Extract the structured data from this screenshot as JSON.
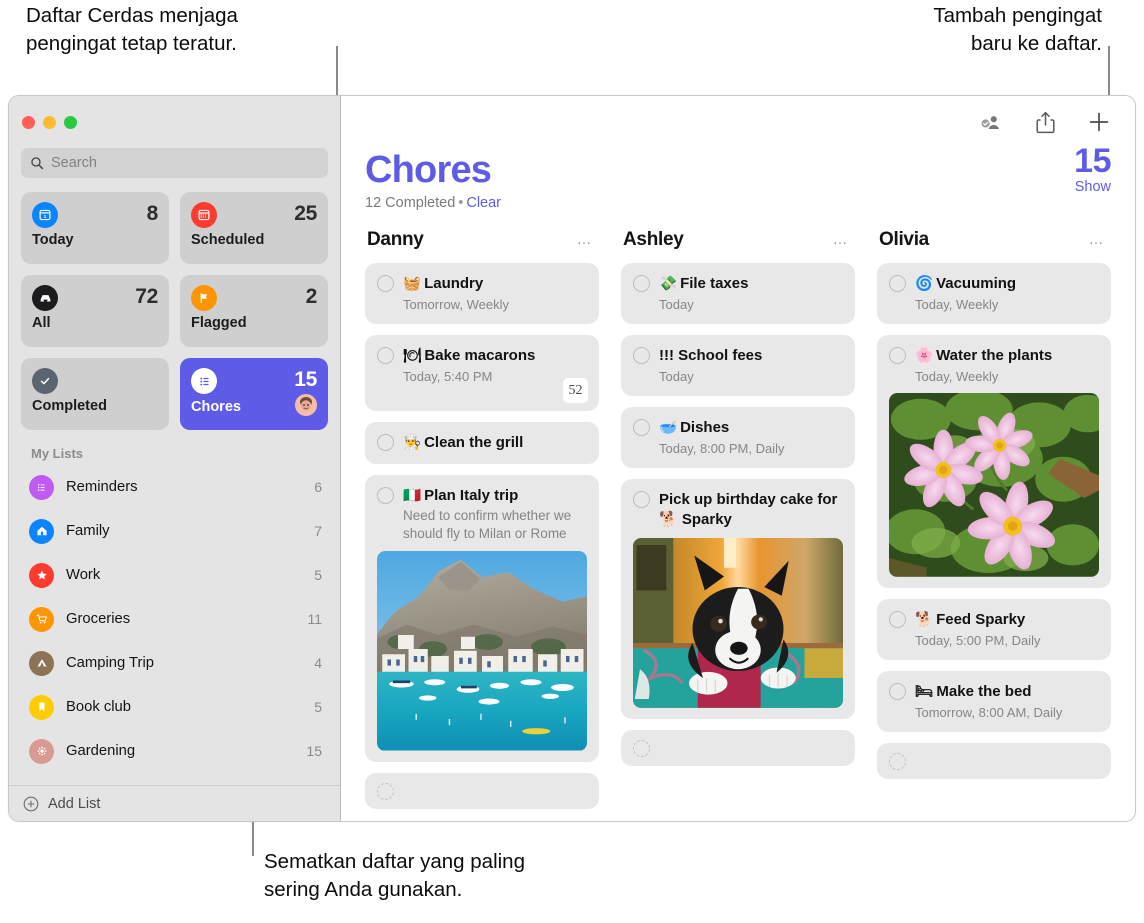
{
  "callouts": {
    "top_left": "Daftar Cerdas menjaga\npengingat tetap teratur.",
    "top_right": "Tambah pengingat\nbaru ke daftar.",
    "bottom": "Sematkan daftar yang paling\nsering Anda gunakan."
  },
  "colors": {
    "accent": "#5e5ce6",
    "sidebar_bg": "#e4e4e4",
    "card_bg": "#e8e8e8",
    "tile_bg": "#cfcfcf"
  },
  "window_controls": {
    "close": "close-button",
    "minimize": "minimize-button",
    "zoom": "zoom-button"
  },
  "sidebar": {
    "search": {
      "placeholder": "Search",
      "value": ""
    },
    "tiles": [
      {
        "label": "Today",
        "count": "8",
        "icon": "calendar-today-icon",
        "color": "#0a84ff",
        "selected": false
      },
      {
        "label": "Scheduled",
        "count": "25",
        "icon": "calendar-icon",
        "color": "#ff3b30",
        "selected": false
      },
      {
        "label": "All",
        "count": "72",
        "icon": "inbox-icon",
        "color": "#1c1c1e",
        "selected": false
      },
      {
        "label": "Flagged",
        "count": "2",
        "icon": "flag-icon",
        "color": "#ff9500",
        "selected": false
      },
      {
        "label": "Completed",
        "count": "",
        "icon": "checkmark-icon",
        "color": "#5b6570",
        "selected": false
      },
      {
        "label": "Chores",
        "count": "15",
        "icon": "list-bullet-icon",
        "color": "#ffffff",
        "selected": true,
        "shared_avatar": "avatar-person"
      }
    ],
    "my_lists_header": "My Lists",
    "lists": [
      {
        "label": "Reminders",
        "count": "6",
        "icon": "list-bullet-icon",
        "color": "#bf5af2"
      },
      {
        "label": "Family",
        "count": "7",
        "icon": "house-icon",
        "color": "#0a84ff"
      },
      {
        "label": "Work",
        "count": "5",
        "icon": "star-icon",
        "color": "#ff3b30"
      },
      {
        "label": "Groceries",
        "count": "11",
        "icon": "cart-icon",
        "color": "#ff9500"
      },
      {
        "label": "Camping Trip",
        "count": "4",
        "icon": "tent-icon",
        "color": "#8d7355"
      },
      {
        "label": "Book club",
        "count": "5",
        "icon": "bookmark-icon",
        "color": "#ffcc00"
      },
      {
        "label": "Gardening",
        "count": "15",
        "icon": "flower-icon",
        "color": "#d99a94"
      }
    ],
    "add_list": {
      "label": "Add List",
      "icon": "plus-circle-icon"
    }
  },
  "toolbar": {
    "share_people_label": "share-people-icon",
    "share_label": "share-icon",
    "add_label": "plus-icon"
  },
  "header": {
    "title": "Chores",
    "completed_text": "12 Completed",
    "separator": "•",
    "clear_label": "Clear",
    "count": "15",
    "show_label": "Show"
  },
  "columns": [
    {
      "name": "Danny",
      "menu": "…",
      "items": [
        {
          "emoji": "🧺",
          "title": "Laundry",
          "meta": "Tomorrow, Weekly"
        },
        {
          "emoji": "🍽",
          "title": "Bake macarons",
          "meta": "Today, 5:40 PM",
          "badge": "52"
        },
        {
          "emoji": "👨‍🍳",
          "title": "Clean the grill",
          "meta": ""
        },
        {
          "emoji": "🇮🇹",
          "title": "Plan Italy trip",
          "note": "Need to confirm whether we should fly to Milan or Rome",
          "photo": "coastal-village-photo"
        },
        {
          "title": "",
          "empty": true
        }
      ]
    },
    {
      "name": "Ashley",
      "menu": "…",
      "items": [
        {
          "emoji": "💸",
          "title": "File taxes",
          "meta": "Today"
        },
        {
          "emoji": "",
          "title": "!!! School fees",
          "meta": "Today"
        },
        {
          "emoji": "🥣",
          "title": "Dishes",
          "meta": "Today, 8:00 PM, Daily"
        },
        {
          "emoji": "",
          "title": "Pick up birthday cake for 🐕 Sparky",
          "photo": "boston-terrier-photo"
        },
        {
          "title": "",
          "empty": true
        }
      ]
    },
    {
      "name": "Olivia",
      "menu": "…",
      "items": [
        {
          "emoji": "🌀",
          "title": "Vacuuming",
          "meta": "Today, Weekly"
        },
        {
          "emoji": "🌸",
          "title": "Water the plants",
          "meta": "Today, Weekly",
          "photo": "pink-cosmos-flowers-photo"
        },
        {
          "emoji": "🐕",
          "title": "Feed Sparky",
          "meta": "Today, 5:00 PM, Daily"
        },
        {
          "emoji": "🛏",
          "title": "Make the bed",
          "meta": "Tomorrow, 8:00 AM, Daily"
        },
        {
          "title": "",
          "empty": true
        }
      ]
    }
  ]
}
